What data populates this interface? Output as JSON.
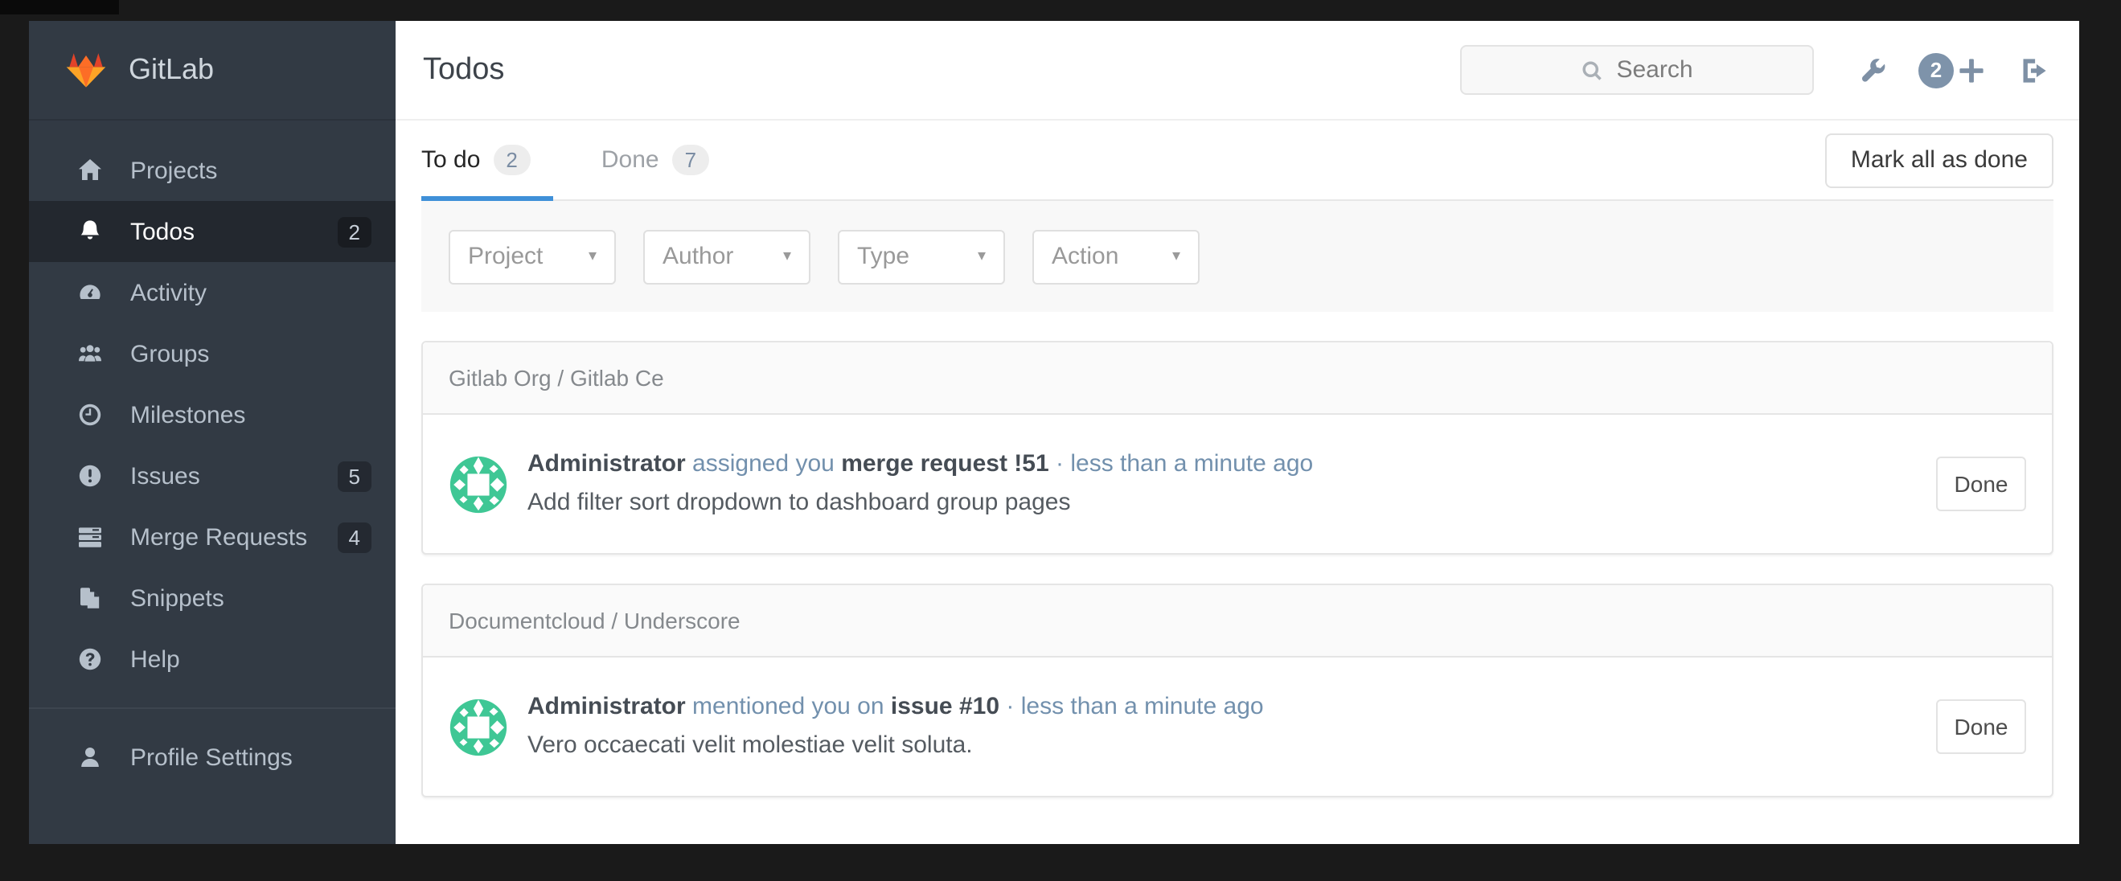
{
  "sidebar": {
    "logo_text": "GitLab",
    "items": [
      {
        "label": "Projects",
        "icon": "home-icon"
      },
      {
        "label": "Todos",
        "icon": "bell-icon",
        "badge": "2",
        "active": true
      },
      {
        "label": "Activity",
        "icon": "dashboard-icon"
      },
      {
        "label": "Groups",
        "icon": "users-icon"
      },
      {
        "label": "Milestones",
        "icon": "clock-icon"
      },
      {
        "label": "Issues",
        "icon": "exclamation-circle-icon",
        "badge": "5"
      },
      {
        "label": "Merge Requests",
        "icon": "stack-icon",
        "badge": "4"
      },
      {
        "label": "Snippets",
        "icon": "file-copy-icon"
      },
      {
        "label": "Help",
        "icon": "question-circle-icon"
      }
    ],
    "footer_items": [
      {
        "label": "Profile Settings",
        "icon": "user-icon"
      }
    ]
  },
  "header": {
    "title": "Todos",
    "search_placeholder": "Search",
    "notification_count": "2",
    "icons": [
      "wrench-icon",
      "notification-count-badge",
      "plus-icon",
      "sign-out-icon"
    ]
  },
  "tabs": [
    {
      "label": "To do",
      "count": "2",
      "active": true
    },
    {
      "label": "Done",
      "count": "7",
      "active": false
    }
  ],
  "toolbar": {
    "mark_all_label": "Mark all as done"
  },
  "filters": [
    {
      "label": "Project"
    },
    {
      "label": "Author"
    },
    {
      "label": "Type"
    },
    {
      "label": "Action"
    }
  ],
  "todo_groups": [
    {
      "project": "Gitlab Org / Gitlab Ce",
      "items": [
        {
          "author": "Administrator",
          "action": "assigned you",
          "target": "merge request !51",
          "separator": "·",
          "time": "less than a minute ago",
          "body": "Add filter sort dropdown to dashboard group pages",
          "button": "Done"
        }
      ]
    },
    {
      "project": "Documentcloud / Underscore",
      "items": [
        {
          "author": "Administrator",
          "action": "mentioned you on",
          "target": "issue #10",
          "separator": "·",
          "time": "less than a minute ago",
          "body": "Vero occaecati velit molestiae velit soluta.",
          "button": "Done"
        }
      ]
    }
  ],
  "colors": {
    "frame": "#1a1a1a",
    "sidebar_bg": "#323a44",
    "sidebar_active_bg": "#23282f",
    "tab_underline_blue": "#3f90d8",
    "link_slate_blue": "#7290ad",
    "avatar_green": "#3fc795",
    "notification_badge": "#7e93aa",
    "logo_red": "#e24329",
    "logo_orange": "#fc6d26",
    "logo_yellow": "#fca326"
  }
}
